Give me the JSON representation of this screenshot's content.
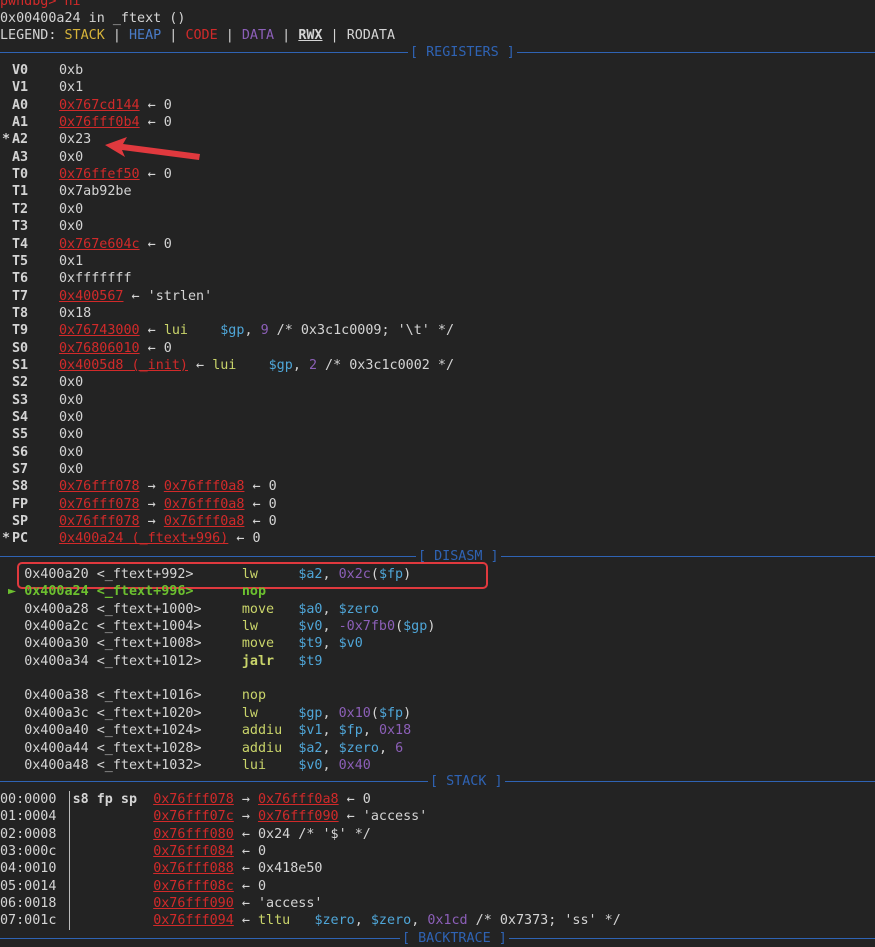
{
  "prompt": "pwndbg> ni",
  "location": "0x00400a24 in _ftext ()",
  "legend": {
    "label": "LEGEND: ",
    "stack": "STACK",
    "heap": "HEAP",
    "code": "CODE",
    "data": "DATA",
    "rwx": "RWX",
    "rodata": "RODATA",
    "sep": " | "
  },
  "sections": {
    "registers": "[ REGISTERS ]",
    "disasm": "[ DISASM ]",
    "stack": "[ STACK ]",
    "backtrace": "[ BACKTRACE ]"
  },
  "registers": [
    {
      "name": "V0",
      "changed": "",
      "plain": "0xb",
      "addr": "",
      "rest": ""
    },
    {
      "name": "V1",
      "changed": "",
      "plain": "0x1",
      "addr": "",
      "rest": ""
    },
    {
      "name": "A0",
      "changed": "",
      "plain": "",
      "addr": "0x767cd144",
      "rest": " ← 0"
    },
    {
      "name": "A1",
      "changed": "",
      "plain": "",
      "addr": "0x76fff0b4",
      "rest": " ← 0"
    },
    {
      "name": "A2",
      "changed": "*",
      "plain": "0x23",
      "addr": "",
      "rest": ""
    },
    {
      "name": "A3",
      "changed": "",
      "plain": "0x0",
      "addr": "",
      "rest": ""
    },
    {
      "name": "T0",
      "changed": "",
      "plain": "",
      "addr": "0x76ffef50",
      "rest": " ← 0"
    },
    {
      "name": "T1",
      "changed": "",
      "plain": "0x7ab92be",
      "addr": "",
      "rest": ""
    },
    {
      "name": "T2",
      "changed": "",
      "plain": "0x0",
      "addr": "",
      "rest": ""
    },
    {
      "name": "T3",
      "changed": "",
      "plain": "0x0",
      "addr": "",
      "rest": ""
    },
    {
      "name": "T4",
      "changed": "",
      "plain": "",
      "addr": "0x767e604c",
      "rest": " ← 0"
    },
    {
      "name": "T5",
      "changed": "",
      "plain": "0x1",
      "addr": "",
      "rest": ""
    },
    {
      "name": "T6",
      "changed": "",
      "plain": "0xfffffff",
      "addr": "",
      "rest": ""
    },
    {
      "name": "T7",
      "changed": "",
      "plain": "",
      "addr": "0x400567",
      "rest": " ← 'strlen'"
    },
    {
      "name": "T8",
      "changed": "",
      "plain": "0x18",
      "addr": "",
      "rest": ""
    },
    {
      "name": "T9",
      "changed": "",
      "plain": "",
      "addr": "0x76743000",
      "special": "t9"
    },
    {
      "name": "S0",
      "changed": "",
      "plain": "",
      "addr": "0x76806010",
      "rest": " ← 0"
    },
    {
      "name": "S1",
      "changed": "",
      "plain": "",
      "addr": "0x4005d8 (_init)",
      "special": "s1"
    },
    {
      "name": "S2",
      "changed": "",
      "plain": "0x0",
      "addr": "",
      "rest": ""
    },
    {
      "name": "S3",
      "changed": "",
      "plain": "0x0",
      "addr": "",
      "rest": ""
    },
    {
      "name": "S4",
      "changed": "",
      "plain": "0x0",
      "addr": "",
      "rest": ""
    },
    {
      "name": "S5",
      "changed": "",
      "plain": "0x0",
      "addr": "",
      "rest": ""
    },
    {
      "name": "S6",
      "changed": "",
      "plain": "0x0",
      "addr": "",
      "rest": ""
    },
    {
      "name": "S7",
      "changed": "",
      "plain": "0x0",
      "addr": "",
      "rest": ""
    },
    {
      "name": "S8",
      "changed": "",
      "plain": "",
      "addr": "0x76fff078",
      "addr2": "0x76fff0a8",
      "rest": " ← 0"
    },
    {
      "name": "FP",
      "changed": "",
      "plain": "",
      "addr": "0x76fff078",
      "addr2": "0x76fff0a8",
      "rest": " ← 0"
    },
    {
      "name": "SP",
      "changed": "",
      "plain": "",
      "addr": "0x76fff078",
      "addr2": "0x76fff0a8",
      "rest": " ← 0"
    },
    {
      "name": "PC",
      "changed": "*",
      "plain": "",
      "addr": "0x400a24 (_ftext+996)",
      "rest": " ← 0"
    }
  ],
  "t9_insn": {
    "arrow": " ← ",
    "mn": "lui",
    "reg": "$gp",
    "sep": ", ",
    "imm": "9",
    "cmt": " /* 0x3c1c0009; '\\t' */"
  },
  "s1_insn": {
    "arrow": " ← ",
    "mn": "lui",
    "reg": "$gp",
    "sep": ", ",
    "imm": "2",
    "cmt": " /* 0x3c1c0002 */"
  },
  "disasm": [
    {
      "addr": "0x400a20",
      "sym": "<_ftext+992>",
      "mn": "lw",
      "ops": [
        [
          "$a2",
          "cyan"
        ],
        [
          ", ",
          ""
        ],
        [
          "0x2c",
          "purple"
        ],
        [
          "(",
          ""
        ],
        [
          "$fp",
          "cyan"
        ],
        [
          ")",
          ""
        ]
      ],
      "current": false
    },
    {
      "addr": "0x400a24",
      "sym": "<_ftext+996>",
      "mn": "nop",
      "ops": [],
      "current": true
    },
    {
      "addr": "0x400a28",
      "sym": "<_ftext+1000>",
      "mn": "move",
      "ops": [
        [
          "$a0",
          "cyan"
        ],
        [
          ", ",
          ""
        ],
        [
          "$zero",
          "cyan"
        ]
      ],
      "current": false
    },
    {
      "addr": "0x400a2c",
      "sym": "<_ftext+1004>",
      "mn": "lw",
      "ops": [
        [
          "$v0",
          "cyan"
        ],
        [
          ", ",
          ""
        ],
        [
          "-0x7fb0",
          "purple"
        ],
        [
          "(",
          ""
        ],
        [
          "$gp",
          "cyan"
        ],
        [
          ")",
          ""
        ]
      ],
      "current": false
    },
    {
      "addr": "0x400a30",
      "sym": "<_ftext+1008>",
      "mn": "move",
      "ops": [
        [
          "$t9",
          "cyan"
        ],
        [
          ", ",
          ""
        ],
        [
          "$v0",
          "cyan"
        ]
      ],
      "current": false
    },
    {
      "addr": "0x400a34",
      "sym": "<_ftext+1012>",
      "mn": "jalr",
      "ops": [
        [
          "$t9",
          "cyan"
        ]
      ],
      "current": false,
      "jump": true
    },
    {
      "addr": "0x400a38",
      "sym": "<_ftext+1016>",
      "mn": "nop",
      "ops": [],
      "current": false
    },
    {
      "addr": "0x400a3c",
      "sym": "<_ftext+1020>",
      "mn": "lw",
      "ops": [
        [
          "$gp",
          "cyan"
        ],
        [
          ", ",
          ""
        ],
        [
          "0x10",
          "purple"
        ],
        [
          "(",
          ""
        ],
        [
          "$fp",
          "cyan"
        ],
        [
          ")",
          ""
        ]
      ],
      "current": false
    },
    {
      "addr": "0x400a40",
      "sym": "<_ftext+1024>",
      "mn": "addiu",
      "ops": [
        [
          "$v1",
          "cyan"
        ],
        [
          ", ",
          ""
        ],
        [
          "$fp",
          "cyan"
        ],
        [
          ", ",
          ""
        ],
        [
          "0x18",
          "purple"
        ]
      ],
      "current": false
    },
    {
      "addr": "0x400a44",
      "sym": "<_ftext+1028>",
      "mn": "addiu",
      "ops": [
        [
          "$a2",
          "cyan"
        ],
        [
          ", ",
          ""
        ],
        [
          "$zero",
          "cyan"
        ],
        [
          ", ",
          ""
        ],
        [
          "6",
          "purple"
        ]
      ],
      "current": false
    },
    {
      "addr": "0x400a48",
      "sym": "<_ftext+1032>",
      "mn": "lui",
      "ops": [
        [
          "$v0",
          "cyan"
        ],
        [
          ", ",
          ""
        ],
        [
          "0x40",
          "purple"
        ]
      ],
      "current": false
    }
  ],
  "stack": [
    {
      "off": "00:0000",
      "regs": "s8 fp sp",
      "addr": "0x76fff078",
      "addr2": "0x76fff0a8",
      "rest": " ← 0"
    },
    {
      "off": "01:0004",
      "regs": "",
      "addr": "0x76fff07c",
      "addr2": "0x76fff090",
      "rest": " ← 'access'"
    },
    {
      "off": "02:0008",
      "regs": "",
      "addr": "0x76fff080",
      "rest": " ← 0x24 /* '$' */"
    },
    {
      "off": "03:000c",
      "regs": "",
      "addr": "0x76fff084",
      "rest": " ← 0"
    },
    {
      "off": "04:0010",
      "regs": "",
      "addr": "0x76fff088",
      "rest": " ← 0x418e50"
    },
    {
      "off": "05:0014",
      "regs": "",
      "addr": "0x76fff08c",
      "rest": " ← 0"
    },
    {
      "off": "06:0018",
      "regs": "",
      "addr": "0x76fff090",
      "rest": " ← 'access'"
    },
    {
      "off": "07:001c",
      "regs": "",
      "addr": "0x76fff094",
      "special": "tltu"
    }
  ],
  "tltu_insn": {
    "arrow": " ← ",
    "mn": "tltu",
    "a": "$zero",
    "b": "$zero",
    "imm": "0x1cd",
    "cmt": " /* 0x7373; 'ss' */"
  },
  "arrow_right": " → "
}
